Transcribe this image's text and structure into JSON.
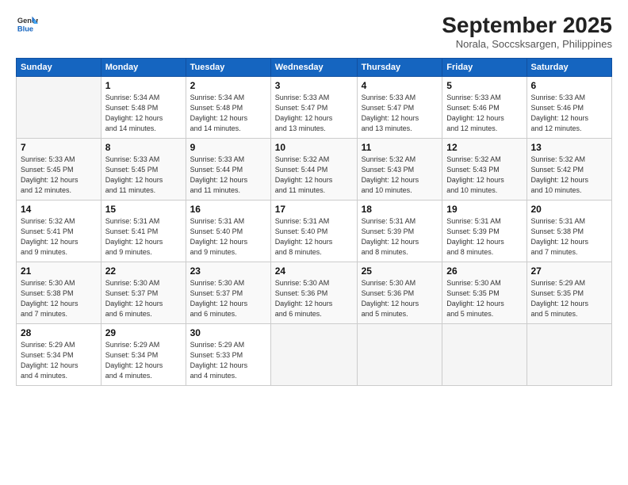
{
  "header": {
    "logo_line1": "General",
    "logo_line2": "Blue",
    "month": "September 2025",
    "location": "Norala, Soccsksargen, Philippines"
  },
  "weekdays": [
    "Sunday",
    "Monday",
    "Tuesday",
    "Wednesday",
    "Thursday",
    "Friday",
    "Saturday"
  ],
  "weeks": [
    [
      {
        "day": "",
        "info": ""
      },
      {
        "day": "1",
        "info": "Sunrise: 5:34 AM\nSunset: 5:48 PM\nDaylight: 12 hours\nand 14 minutes."
      },
      {
        "day": "2",
        "info": "Sunrise: 5:34 AM\nSunset: 5:48 PM\nDaylight: 12 hours\nand 14 minutes."
      },
      {
        "day": "3",
        "info": "Sunrise: 5:33 AM\nSunset: 5:47 PM\nDaylight: 12 hours\nand 13 minutes."
      },
      {
        "day": "4",
        "info": "Sunrise: 5:33 AM\nSunset: 5:47 PM\nDaylight: 12 hours\nand 13 minutes."
      },
      {
        "day": "5",
        "info": "Sunrise: 5:33 AM\nSunset: 5:46 PM\nDaylight: 12 hours\nand 12 minutes."
      },
      {
        "day": "6",
        "info": "Sunrise: 5:33 AM\nSunset: 5:46 PM\nDaylight: 12 hours\nand 12 minutes."
      }
    ],
    [
      {
        "day": "7",
        "info": "Sunrise: 5:33 AM\nSunset: 5:45 PM\nDaylight: 12 hours\nand 12 minutes."
      },
      {
        "day": "8",
        "info": "Sunrise: 5:33 AM\nSunset: 5:45 PM\nDaylight: 12 hours\nand 11 minutes."
      },
      {
        "day": "9",
        "info": "Sunrise: 5:33 AM\nSunset: 5:44 PM\nDaylight: 12 hours\nand 11 minutes."
      },
      {
        "day": "10",
        "info": "Sunrise: 5:32 AM\nSunset: 5:44 PM\nDaylight: 12 hours\nand 11 minutes."
      },
      {
        "day": "11",
        "info": "Sunrise: 5:32 AM\nSunset: 5:43 PM\nDaylight: 12 hours\nand 10 minutes."
      },
      {
        "day": "12",
        "info": "Sunrise: 5:32 AM\nSunset: 5:43 PM\nDaylight: 12 hours\nand 10 minutes."
      },
      {
        "day": "13",
        "info": "Sunrise: 5:32 AM\nSunset: 5:42 PM\nDaylight: 12 hours\nand 10 minutes."
      }
    ],
    [
      {
        "day": "14",
        "info": "Sunrise: 5:32 AM\nSunset: 5:41 PM\nDaylight: 12 hours\nand 9 minutes."
      },
      {
        "day": "15",
        "info": "Sunrise: 5:31 AM\nSunset: 5:41 PM\nDaylight: 12 hours\nand 9 minutes."
      },
      {
        "day": "16",
        "info": "Sunrise: 5:31 AM\nSunset: 5:40 PM\nDaylight: 12 hours\nand 9 minutes."
      },
      {
        "day": "17",
        "info": "Sunrise: 5:31 AM\nSunset: 5:40 PM\nDaylight: 12 hours\nand 8 minutes."
      },
      {
        "day": "18",
        "info": "Sunrise: 5:31 AM\nSunset: 5:39 PM\nDaylight: 12 hours\nand 8 minutes."
      },
      {
        "day": "19",
        "info": "Sunrise: 5:31 AM\nSunset: 5:39 PM\nDaylight: 12 hours\nand 8 minutes."
      },
      {
        "day": "20",
        "info": "Sunrise: 5:31 AM\nSunset: 5:38 PM\nDaylight: 12 hours\nand 7 minutes."
      }
    ],
    [
      {
        "day": "21",
        "info": "Sunrise: 5:30 AM\nSunset: 5:38 PM\nDaylight: 12 hours\nand 7 minutes."
      },
      {
        "day": "22",
        "info": "Sunrise: 5:30 AM\nSunset: 5:37 PM\nDaylight: 12 hours\nand 6 minutes."
      },
      {
        "day": "23",
        "info": "Sunrise: 5:30 AM\nSunset: 5:37 PM\nDaylight: 12 hours\nand 6 minutes."
      },
      {
        "day": "24",
        "info": "Sunrise: 5:30 AM\nSunset: 5:36 PM\nDaylight: 12 hours\nand 6 minutes."
      },
      {
        "day": "25",
        "info": "Sunrise: 5:30 AM\nSunset: 5:36 PM\nDaylight: 12 hours\nand 5 minutes."
      },
      {
        "day": "26",
        "info": "Sunrise: 5:30 AM\nSunset: 5:35 PM\nDaylight: 12 hours\nand 5 minutes."
      },
      {
        "day": "27",
        "info": "Sunrise: 5:29 AM\nSunset: 5:35 PM\nDaylight: 12 hours\nand 5 minutes."
      }
    ],
    [
      {
        "day": "28",
        "info": "Sunrise: 5:29 AM\nSunset: 5:34 PM\nDaylight: 12 hours\nand 4 minutes."
      },
      {
        "day": "29",
        "info": "Sunrise: 5:29 AM\nSunset: 5:34 PM\nDaylight: 12 hours\nand 4 minutes."
      },
      {
        "day": "30",
        "info": "Sunrise: 5:29 AM\nSunset: 5:33 PM\nDaylight: 12 hours\nand 4 minutes."
      },
      {
        "day": "",
        "info": ""
      },
      {
        "day": "",
        "info": ""
      },
      {
        "day": "",
        "info": ""
      },
      {
        "day": "",
        "info": ""
      }
    ]
  ]
}
